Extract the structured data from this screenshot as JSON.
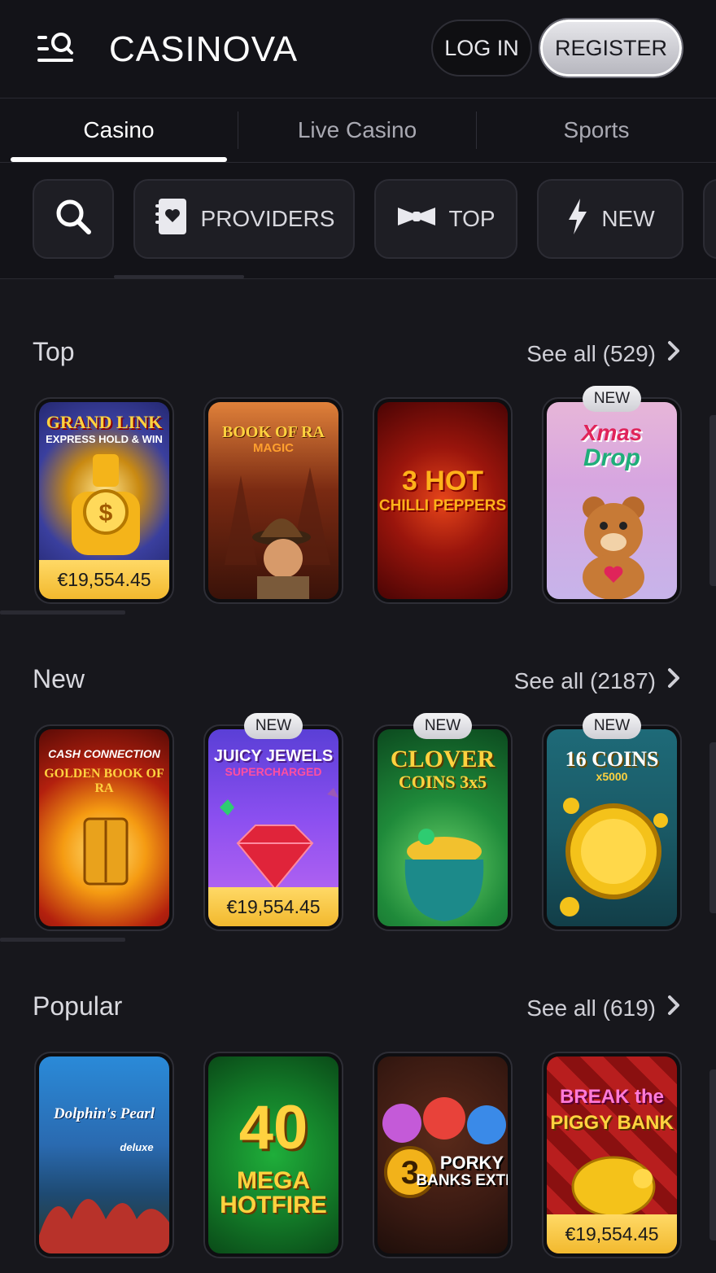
{
  "header": {
    "logo": "CASINOVA",
    "login_label": "LOG IN",
    "register_label": "REGISTER",
    "menu_icon": "menu-search-icon"
  },
  "tabs": [
    {
      "label": "Casino",
      "active": true
    },
    {
      "label": "Live Casino",
      "active": false
    },
    {
      "label": "Sports",
      "active": false
    }
  ],
  "filters": [
    {
      "label": "",
      "icon": "search-icon"
    },
    {
      "label": "PROVIDERS",
      "icon": "providers-icon"
    },
    {
      "label": "TOP",
      "icon": "bowtie-icon"
    },
    {
      "label": "NEW",
      "icon": "lightning-icon"
    }
  ],
  "sections": [
    {
      "title": "Top",
      "see_all": "See all (529)",
      "games": [
        {
          "title": "GRAND LINK",
          "subtitle": "EXPRESS HOLD & WIN",
          "jackpot": "€19,554.45",
          "badge": ""
        },
        {
          "title": "BOOK OF RA",
          "subtitle": "MAGIC",
          "jackpot": "",
          "badge": ""
        },
        {
          "title": "3 HOT",
          "subtitle": "CHILLI PEPPERS",
          "jackpot": "",
          "badge": ""
        },
        {
          "title": "Xmas",
          "subtitle": "Drop",
          "jackpot": "",
          "badge": "NEW"
        }
      ]
    },
    {
      "title": "New",
      "see_all": "See all (2187)",
      "games": [
        {
          "title": "CASH CONNECTION",
          "subtitle": "GOLDEN BOOK OF RA",
          "jackpot": "",
          "badge": ""
        },
        {
          "title": "JUICY JEWELS",
          "subtitle": "SUPERCHARGED",
          "jackpot": "€19,554.45",
          "badge": "NEW"
        },
        {
          "title": "CLOVER",
          "subtitle": "COINS 3x5",
          "jackpot": "",
          "badge": "NEW"
        },
        {
          "title": "16 COINS",
          "subtitle": "x5000",
          "jackpot": "",
          "badge": "NEW"
        }
      ]
    },
    {
      "title": "Popular",
      "see_all": "See all (619)",
      "games": [
        {
          "title": "Dolphin's Pearl",
          "subtitle": "deluxe",
          "jackpot": "",
          "badge": ""
        },
        {
          "title": "40",
          "subtitle": "MEGA HOTFIRE",
          "jackpot": "",
          "badge": ""
        },
        {
          "title": "PORKY",
          "subtitle": "BANKS EXTRA",
          "jackpot": "",
          "badge": ""
        },
        {
          "title": "BREAK the",
          "subtitle": "PIGGY BANK",
          "jackpot": "€19,554.45",
          "badge": ""
        }
      ]
    }
  ],
  "colors": {
    "background": "#17171c",
    "jackpot": "#f2b92e",
    "accent": "#ffffff"
  }
}
